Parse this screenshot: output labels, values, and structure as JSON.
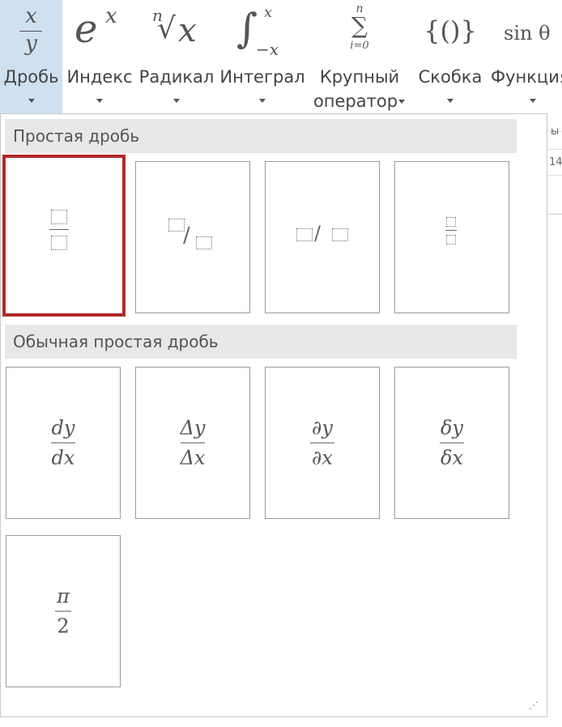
{
  "ribbon": {
    "buttons": [
      {
        "name": "fraction",
        "label": "Дробь",
        "icon_text": "x/y",
        "active": true
      },
      {
        "name": "script",
        "label": "Индекс",
        "icon_text": "e^x"
      },
      {
        "name": "radical",
        "label": "Радикал",
        "icon_text": "ⁿ√x"
      },
      {
        "name": "integral",
        "label": "Интеграл",
        "icon_text": "∫"
      },
      {
        "name": "large-operator",
        "label": "Крупный",
        "label2": "оператор",
        "icon_text": "Σ"
      },
      {
        "name": "bracket",
        "label": "Скобка",
        "icon_text": "{()}"
      },
      {
        "name": "function",
        "label": "Функция",
        "icon_text": "sin θ"
      }
    ],
    "icon": {
      "frac_num": "x",
      "frac_den": "y",
      "script_base": "e",
      "script_sup": "x",
      "radical_index": "n",
      "radical_body": "x",
      "integral_sign": "∫",
      "integral_upper": "x",
      "integral_lower": "−x",
      "sum_sign": "∑",
      "sum_upper": "n",
      "sum_lower": "i=0",
      "bracket": "{()}",
      "function": "sin θ"
    }
  },
  "gallery": {
    "sections": [
      {
        "title": "Простая дробь"
      },
      {
        "title": "Обычная простая дробь"
      }
    ],
    "common_fractions": [
      {
        "num": "dy",
        "den": "dx"
      },
      {
        "num": "Δy",
        "den": "Δx"
      },
      {
        "num": "∂y",
        "den": "∂x"
      },
      {
        "num": "δy",
        "den": "δx"
      },
      {
        "num": "π",
        "den": "2"
      }
    ]
  },
  "edge": {
    "text1": "ы",
    "text2": "14"
  },
  "grip": "⋰"
}
